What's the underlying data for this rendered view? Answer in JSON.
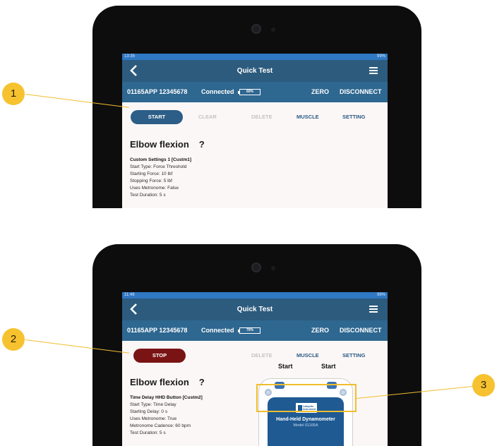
{
  "callouts": [
    "1",
    "2",
    "3"
  ],
  "screen1": {
    "status_time": "13:35",
    "status_right": "99%",
    "app_title": "Quick Test",
    "device_id": "01165APP 12345678",
    "connection": "Connected",
    "battery": "60%",
    "zero": "ZERO",
    "disconnect": "DISCONNECT",
    "actions": {
      "primary": "START",
      "clear": "CLEAR",
      "delete": "DELETE",
      "muscle": "MUSCLE",
      "setting": "SETTING"
    },
    "exercise": "Elbow flexion",
    "help": "?",
    "settings_title": "Custom Settings 1 [Custm1]",
    "settings_lines": [
      "Start Type: Force Threshold",
      "Starting Force: 10 lbf",
      "Stopping Force: 5 lbf",
      "Uses Metronome: False",
      "Test Duration: 5 s"
    ]
  },
  "screen2": {
    "status_time": "11:48",
    "status_right": "98%",
    "app_title": "Quick Test",
    "device_id": "01165APP 12345678",
    "connection": "Connected",
    "battery": "70%",
    "zero": "ZERO",
    "disconnect": "DISCONNECT",
    "actions": {
      "primary": "STOP",
      "delete": "DELETE",
      "muscle": "MUSCLE",
      "setting": "SETTING"
    },
    "exercise": "Elbow flexion",
    "help": "?",
    "settings_title": "Time Delay HHD Button [Custm2]",
    "settings_lines": [
      "Start Type: Time Delay",
      "Starting Delay: 0 s",
      "Uses Metronome: True",
      "Metronome Cadence: 60 bpm",
      "Test Duration: 5 s"
    ],
    "device_buttons": [
      "Start",
      "Start"
    ],
    "device_logo": [
      "Lafayette",
      "Instrument"
    ],
    "device_name": "Hand-Held Dynamometer",
    "device_model": "Model 01165A"
  },
  "colors": {
    "accent": "#f6c22f",
    "appbar": "#2c5b7d",
    "start": "#2c5e87",
    "stop": "#7a1414"
  }
}
